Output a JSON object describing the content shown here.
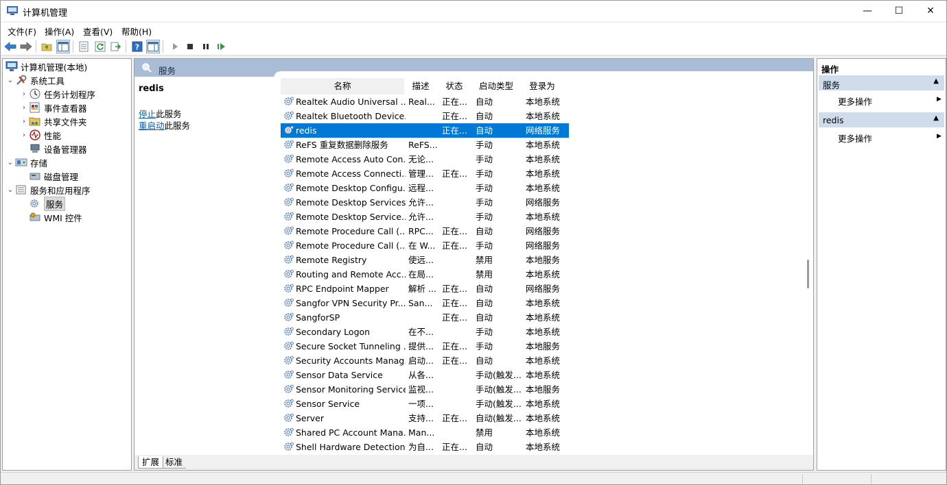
{
  "window": {
    "title": "计算机管理",
    "controls": {
      "minimize": "—",
      "maximize": "☐",
      "close": "✕"
    }
  },
  "menu": [
    "文件(F)",
    "操作(A)",
    "查看(V)",
    "帮助(H)"
  ],
  "toolbar": {
    "icons": [
      "back-icon",
      "forward-icon",
      "up-folder-icon",
      "show-tree-icon",
      "properties-icon",
      "refresh-icon",
      "export-icon",
      "help-icon",
      "view-icon",
      "play-icon",
      "stop-icon",
      "pause-icon",
      "resume-icon"
    ]
  },
  "tree": {
    "items": [
      {
        "label": "计算机管理(本地)",
        "level": 0,
        "expanded": ""
      },
      {
        "label": "系统工具",
        "level": 1,
        "expanded": "open"
      },
      {
        "label": "任务计划程序",
        "level": 2,
        "expanded": "closed"
      },
      {
        "label": "事件查看器",
        "level": 2,
        "expanded": "closed"
      },
      {
        "label": "共享文件夹",
        "level": 2,
        "expanded": "closed"
      },
      {
        "label": "性能",
        "level": 2,
        "expanded": "closed"
      },
      {
        "label": "设备管理器",
        "level": 2,
        "expanded": ""
      },
      {
        "label": "存储",
        "level": 1,
        "expanded": "open"
      },
      {
        "label": "磁盘管理",
        "level": 2,
        "expanded": ""
      },
      {
        "label": "服务和应用程序",
        "level": 1,
        "expanded": "open"
      },
      {
        "label": "服务",
        "level": 2,
        "expanded": "",
        "selected": true
      },
      {
        "label": "WMI 控件",
        "level": 2,
        "expanded": ""
      }
    ]
  },
  "center": {
    "header": "服务",
    "selected_service": "redis",
    "stop_link": "停止",
    "stop_suffix": "此服务",
    "restart_link": "重启动",
    "restart_suffix": "此服务",
    "columns": [
      "名称",
      "描述",
      "状态",
      "启动类型",
      "登录为"
    ],
    "rows": [
      [
        "Realtek Audio Universal ...",
        "Real...",
        "正在...",
        "自动",
        "本地系统"
      ],
      [
        "Realtek Bluetooth Device...",
        "",
        "正在...",
        "自动",
        "本地系统"
      ],
      [
        "redis",
        "",
        "正在...",
        "自动",
        "网络服务"
      ],
      [
        "ReFS 重复数据删除服务",
        "ReFS...",
        "",
        "手动",
        "本地系统"
      ],
      [
        "Remote Access Auto Con...",
        "无论...",
        "",
        "手动",
        "本地系统"
      ],
      [
        "Remote Access Connecti...",
        "管理...",
        "正在...",
        "手动",
        "本地系统"
      ],
      [
        "Remote Desktop Configu...",
        "远程...",
        "",
        "手动",
        "本地系统"
      ],
      [
        "Remote Desktop Services",
        "允许...",
        "",
        "手动",
        "网络服务"
      ],
      [
        "Remote Desktop Service...",
        "允许...",
        "",
        "手动",
        "本地系统"
      ],
      [
        "Remote Procedure Call (...",
        "RPC...",
        "正在...",
        "自动",
        "网络服务"
      ],
      [
        "Remote Procedure Call (...",
        "在 W...",
        "正在...",
        "手动",
        "网络服务"
      ],
      [
        "Remote Registry",
        "使远...",
        "",
        "禁用",
        "本地服务"
      ],
      [
        "Routing and Remote Acc...",
        "在局...",
        "",
        "禁用",
        "本地系统"
      ],
      [
        "RPC Endpoint Mapper",
        "解析 ...",
        "正在...",
        "自动",
        "网络服务"
      ],
      [
        "Sangfor VPN Security Pr...",
        "San...",
        "正在...",
        "自动",
        "本地系统"
      ],
      [
        "SangforSP",
        "",
        "正在...",
        "自动",
        "本地系统"
      ],
      [
        "Secondary Logon",
        "在不...",
        "",
        "手动",
        "本地系统"
      ],
      [
        "Secure Socket Tunneling ...",
        "提供...",
        "正在...",
        "手动",
        "本地服务"
      ],
      [
        "Security Accounts Manag...",
        "启动...",
        "正在...",
        "自动",
        "本地系统"
      ],
      [
        "Sensor Data Service",
        "从各...",
        "",
        "手动(触发...",
        "本地系统"
      ],
      [
        "Sensor Monitoring Service",
        "监视...",
        "",
        "手动(触发...",
        "本地服务"
      ],
      [
        "Sensor Service",
        "一项...",
        "",
        "手动(触发...",
        "本地系统"
      ],
      [
        "Server",
        "支持...",
        "正在...",
        "自动(触发...",
        "本地系统"
      ],
      [
        "Shared PC Account Mana...",
        "Man...",
        "",
        "禁用",
        "本地系统"
      ],
      [
        "Shell Hardware Detection",
        "为自...",
        "正在...",
        "自动",
        "本地系统"
      ]
    ],
    "tabs": [
      "扩展",
      "标准"
    ]
  },
  "actions": {
    "title": "操作",
    "sections": [
      {
        "label": "服务",
        "item": "更多操作"
      },
      {
        "label": "redis",
        "item": "更多操作"
      }
    ]
  },
  "colors": {
    "selection": "#0078d7",
    "header_band": "#a9bdd6",
    "action_section": "#cfdcec"
  }
}
